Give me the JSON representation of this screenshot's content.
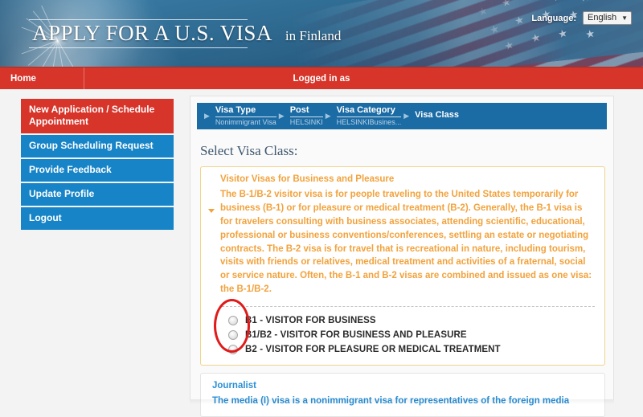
{
  "header": {
    "title": "APPLY FOR A U.S. VISA",
    "country": "in  Finland",
    "language_label": "Language:",
    "language_value": "English",
    "caret": "▼"
  },
  "nav": {
    "home": "Home",
    "logged_in_as": "Logged in as"
  },
  "sidebar": {
    "items": [
      {
        "label": "New Application / Schedule Appointment",
        "active": true
      },
      {
        "label": "Group Scheduling Request",
        "active": false
      },
      {
        "label": "Provide Feedback",
        "active": false
      },
      {
        "label": "Update Profile",
        "active": false
      },
      {
        "label": "Logout",
        "active": false
      }
    ]
  },
  "breadcrumb": {
    "arrow": "▶",
    "steps": [
      {
        "label": "Visa Type",
        "sub": "Nonimmigrant Visa"
      },
      {
        "label": "Post",
        "sub": "HELSINKI"
      },
      {
        "label": "Visa Category",
        "sub": "HELSINKIBusines..."
      },
      {
        "label": "Visa Class",
        "sub": ""
      }
    ]
  },
  "main": {
    "heading": "Select Visa Class:",
    "cards": [
      {
        "title": "Visitor Visas for Business and Pleasure",
        "body": "The B-1/B-2 visitor visa is for people traveling to the United States temporarily for business (B-1) or for pleasure or medical treatment (B-2). Generally, the B-1 visa is for travelers consulting with business associates, attending scientific, educational, professional or business conventions/conferences, settling an estate or negotiating contracts. The B-2 visa is for travel that is recreational in nature, including tourism, visits with friends or relatives, medical treatment and activities of a fraternal, social or service nature. Often, the B-1 and B-2 visas are combined and issued as one visa: the B-1/B-2.",
        "expanded": true
      },
      {
        "title": "Journalist",
        "body": "The media (I) visa is a nonimmigrant visa for representatives of the foreign media",
        "expanded": false
      }
    ],
    "visa_class_options": [
      {
        "label": "B1 - VISITOR FOR BUSINESS",
        "selected": false
      },
      {
        "label": "B1/B2 - VISITOR FOR BUSINESS AND PLEASURE",
        "selected": false
      },
      {
        "label": "B2 - VISITOR FOR PLEASURE OR MEDICAL TREATMENT",
        "selected": false
      }
    ]
  },
  "annotation": {
    "type": "red-ellipse-highlight",
    "target": "visa-class-radio-group",
    "color": "#e01b1b"
  },
  "colors": {
    "brand_blue": "#1b6ba5",
    "brand_red": "#d7342a",
    "sidebar_blue": "#1784c7",
    "accent_orange": "#f2a23c",
    "link_blue": "#2b8fd4"
  }
}
